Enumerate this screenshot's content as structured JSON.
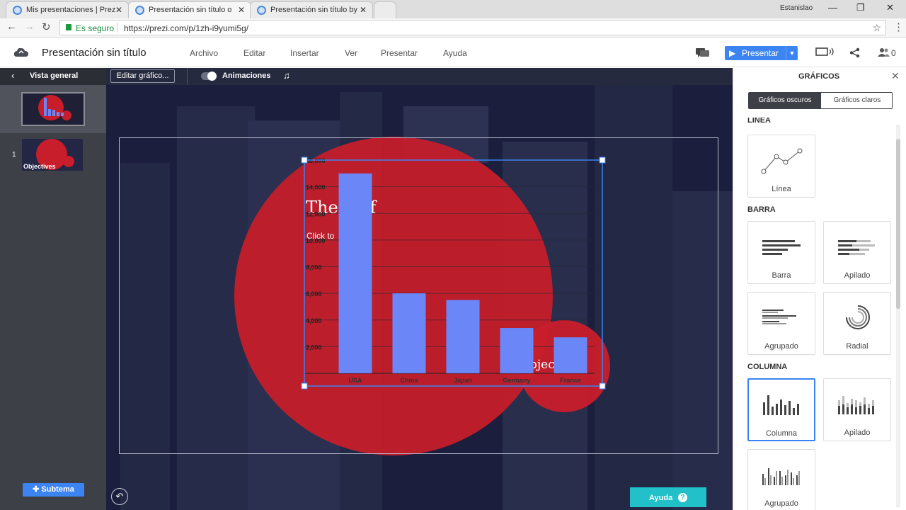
{
  "browser": {
    "tabs": [
      {
        "title": "Mis presentaciones | Prez",
        "active": false
      },
      {
        "title": "Presentación sin título o",
        "active": true
      },
      {
        "title": "Presentación sin título by",
        "active": false
      }
    ],
    "user": "Estanislao",
    "secure_label": "Es seguro",
    "url": "https://prezi.com/p/1zh-i9yumi5g/"
  },
  "app": {
    "title": "Presentación sin título",
    "menu": [
      "Archivo",
      "Editar",
      "Insertar",
      "Ver",
      "Presentar",
      "Ayuda"
    ],
    "present_label": "Presentar",
    "collab_count": "0",
    "icons": [
      "cloud-icon",
      "comments-icon",
      "present-play-icon",
      "display-settings-icon",
      "share-icon",
      "collaborators-icon"
    ]
  },
  "left_panel": {
    "back_label": "Vista general",
    "slides": [
      {
        "number": "1",
        "label": "Objectives"
      }
    ],
    "add_subtopic_label": "Subtema"
  },
  "canvas_toolbar": {
    "edit_chart_label": "Editar gráfico...",
    "animations_label": "Animaciones",
    "animations_enabled": true
  },
  "slide": {
    "title_fragment": "The    ef",
    "body_fragment": "Click to      xt",
    "sub_circle_text": "bjec   s"
  },
  "chart_data": {
    "type": "bar",
    "categories": [
      "USA",
      "China",
      "Japan",
      "Germany",
      "France"
    ],
    "values": [
      15000,
      6000,
      5500,
      3400,
      2700
    ],
    "ylim": [
      0,
      16000
    ],
    "yticks": [
      "2,000",
      "4,000",
      "6,000",
      "8,000",
      "10,000",
      "12,000",
      "14,000",
      "16,000"
    ],
    "bar_color": "#6b86f7",
    "grid": true
  },
  "help_button_label": "Ayuda",
  "right_panel": {
    "title": "GRÁFICOS",
    "theme_tabs": [
      "Gráficos oscuros",
      "Gráficos claros"
    ],
    "sections": [
      {
        "heading": "LÍNEA",
        "items": [
          "Línea"
        ]
      },
      {
        "heading": "BARRA",
        "items": [
          "Barra",
          "Apilado",
          "Agrupado",
          "Radial"
        ]
      },
      {
        "heading": "COLUMNA",
        "items": [
          "Columna",
          "Apilado",
          "Agrupado"
        ]
      }
    ],
    "selected": "Columna"
  },
  "colors": {
    "accent": "#3b84f2",
    "slide_bg": "#1d2142",
    "circle_red": "#c81d2a",
    "help_teal": "#22c0c8"
  }
}
